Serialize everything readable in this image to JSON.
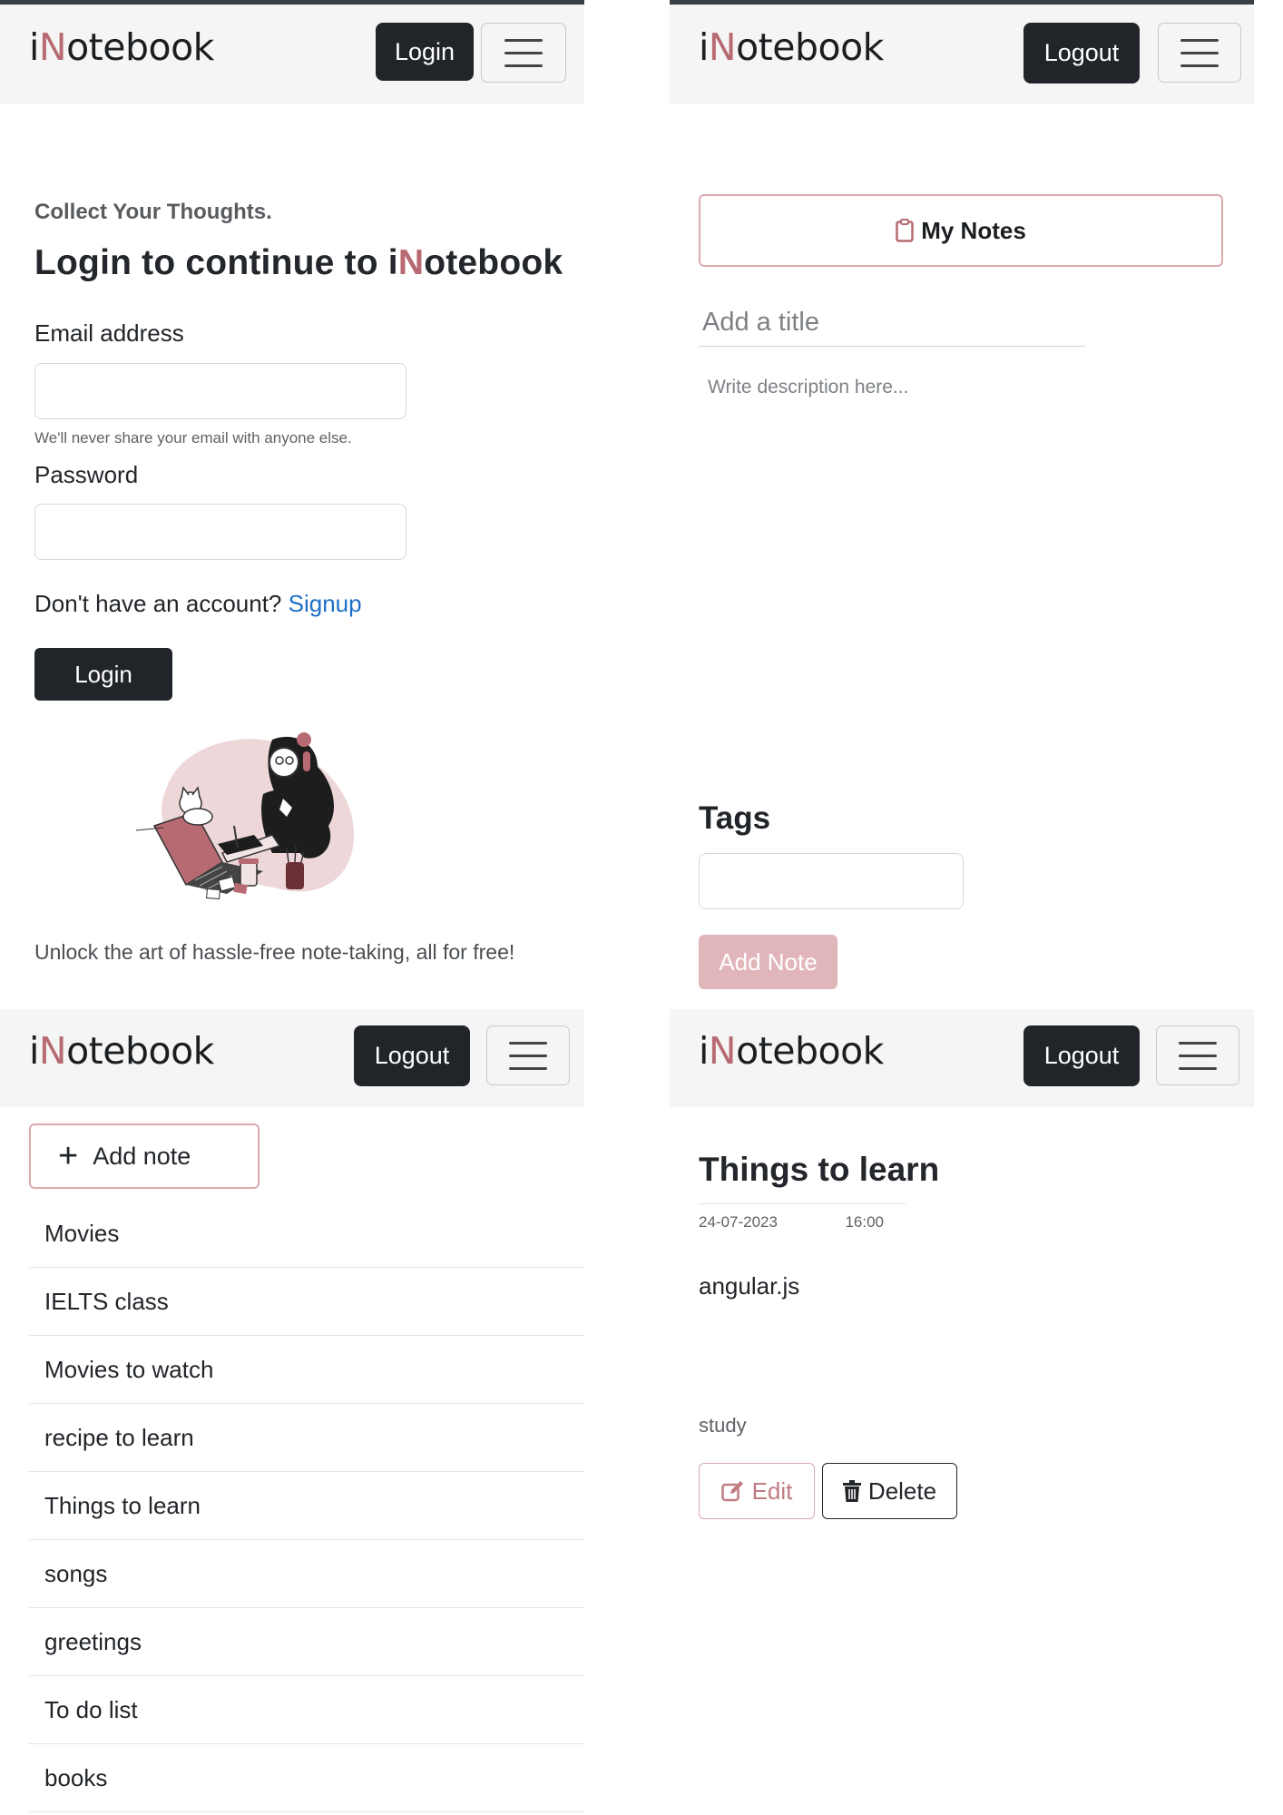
{
  "brand": {
    "prefix": "i",
    "accent": "N",
    "suffix": "otebook"
  },
  "colors": {
    "accent": "#b76a72",
    "dark_button": "#212529",
    "link": "#1e6fc7",
    "disabled_pink": "#e1b6bb"
  },
  "login_screen": {
    "nav_button": "Login",
    "tagline": "Collect Your Thoughts.",
    "heading_prefix": "Login to continue to i",
    "heading_accent": "N",
    "heading_suffix": "otebook",
    "email_label": "Email address",
    "email_help": "We'll never share your email with anyone else.",
    "password_label": "Password",
    "signup_prompt": "Don't have an account?",
    "signup_link": "Signup",
    "submit_button": "Login",
    "footer_text": "Unlock the art of hassle-free note-taking, all for free!"
  },
  "add_note_screen": {
    "nav_button": "Logout",
    "my_notes_button": "My Notes",
    "title_placeholder": "Add a title",
    "description_placeholder": "Write description here...",
    "tags_heading": "Tags",
    "add_note_button": "Add Note"
  },
  "notes_list_screen": {
    "nav_button": "Logout",
    "add_note_button": "Add note",
    "notes": [
      "Movies",
      "IELTS class",
      "Movies to watch",
      "recipe to learn",
      "Things to learn",
      "songs",
      "greetings",
      "To do list",
      "books"
    ]
  },
  "note_detail_screen": {
    "nav_button": "Logout",
    "title": "Things to learn",
    "date": "24-07-2023",
    "time": "16:00",
    "description": "angular.js",
    "tag": "study",
    "edit_button": "Edit",
    "delete_button": "Delete"
  }
}
